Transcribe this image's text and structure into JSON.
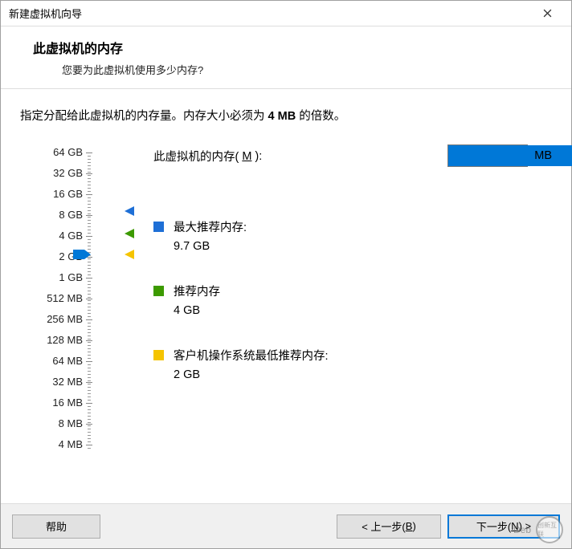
{
  "titlebar": {
    "title": "新建虚拟机向导"
  },
  "header": {
    "title": "此虚拟机的内存",
    "subtitle": "您要为此虚拟机使用多少内存?"
  },
  "instruction": {
    "prefix": "指定分配给此虚拟机的内存量。内存大小必须为 ",
    "bold": "4 MB",
    "suffix": " 的倍数。"
  },
  "memory": {
    "label_prefix": "此虚拟机的内存(",
    "label_accel": "M",
    "label_suffix": "):",
    "value": "2048",
    "unit": "MB"
  },
  "scale": {
    "ticks": [
      "64 GB",
      "32 GB",
      "16 GB",
      "8 GB",
      "4 GB",
      "2 GB",
      "1 GB",
      "512 MB",
      "256 MB",
      "128 MB",
      "64 MB",
      "32 MB",
      "16 MB",
      "8 MB",
      "4 MB"
    ]
  },
  "recommendations": {
    "max": {
      "label": "最大推荐内存:",
      "value": "9.7 GB",
      "color": "#1e6fd6"
    },
    "rec": {
      "label": "推荐内存",
      "value": "4 GB",
      "color": "#3c9a00"
    },
    "min": {
      "label": "客户机操作系统最低推荐内存:",
      "value": "2 GB",
      "color": "#f5c400"
    }
  },
  "footer": {
    "help": "帮助",
    "prev_prefix": "< 上一步(",
    "prev_accel": "B",
    "prev_suffix": ")",
    "next_prefix": "下一步(",
    "next_accel": "N",
    "next_suffix": ") >",
    "extra": "Deb"
  },
  "watermark": {
    "brand": "创新互联"
  }
}
